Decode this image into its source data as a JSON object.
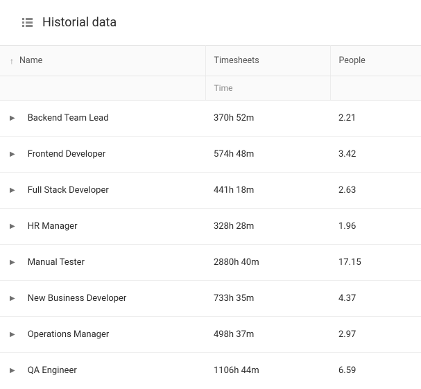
{
  "header": {
    "title": "Historial data"
  },
  "columns": {
    "name": "Name",
    "timesheets": "Timesheets",
    "people": "People",
    "time_sub": "Time"
  },
  "rows": [
    {
      "name": "Backend Team Lead",
      "time": "370h 52m",
      "people": "2.21"
    },
    {
      "name": "Frontend Developer",
      "time": "574h 48m",
      "people": "3.42"
    },
    {
      "name": "Full Stack Developer",
      "time": "441h 18m",
      "people": "2.63"
    },
    {
      "name": "HR Manager",
      "time": "328h 28m",
      "people": "1.96"
    },
    {
      "name": "Manual Tester",
      "time": "2880h 40m",
      "people": "17.15"
    },
    {
      "name": "New Business Developer",
      "time": "733h 35m",
      "people": "4.37"
    },
    {
      "name": "Operations Manager",
      "time": "498h 37m",
      "people": "2.97"
    },
    {
      "name": "QA Engineer",
      "time": "1106h 44m",
      "people": "6.59"
    }
  ]
}
